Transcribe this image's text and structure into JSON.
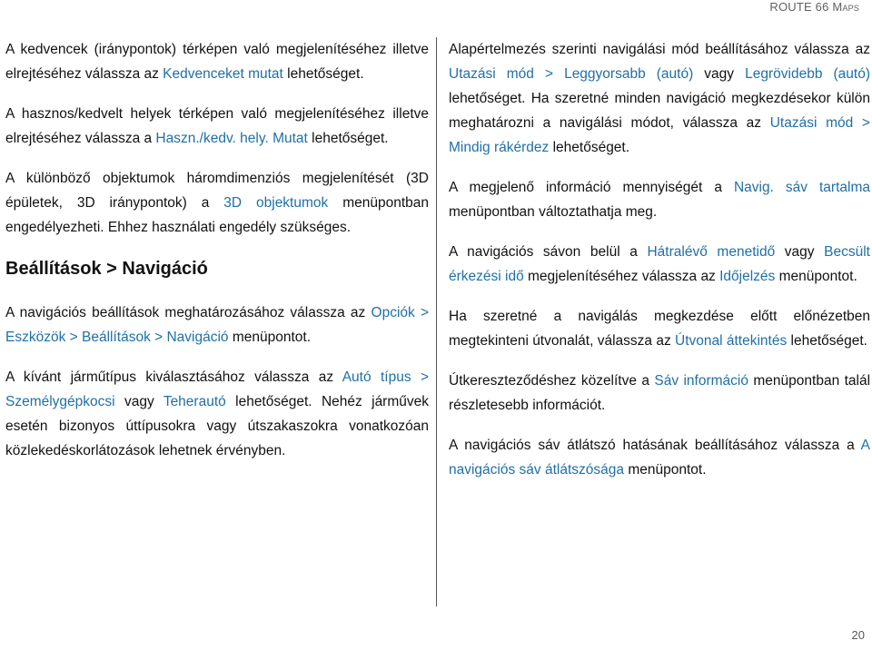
{
  "header": {
    "title_main": "ROUTE 66 ",
    "title_sc": "Maps"
  },
  "left": {
    "p1": {
      "t1": "A kedvencek (iránypontok) térképen való megjelenítéséhez illetve elrejtéséhez válassza az ",
      "l1": "Kedvenceket mutat",
      "t2": " lehetőséget."
    },
    "p2": {
      "t1": "A hasznos/kedvelt helyek térképen való megjelenítéséhez illetve elrejtéséhez válassza a ",
      "l1": "Haszn./kedv. hely. Mutat",
      "t2": " lehetőséget."
    },
    "p3": {
      "t1": "A különböző objektumok háromdimenziós megjelenítését (3D épületek, 3D iránypontok) a ",
      "l1": "3D objektumok",
      "t2": " menüpontban engedélyezheti. Ehhez használati engedély szükséges."
    },
    "heading": "Beállítások > Navigáció",
    "p4": {
      "t1": "A navigációs beállítások meghatározásához válassza az ",
      "l1": "Opciók > Eszközök > Beállítások > Navigáció",
      "t2": " menüpontot."
    },
    "p5": {
      "t1": "A kívánt járműtípus kiválasztásához válassza az ",
      "l1": "Autó típus > Személygépkocsi",
      "t2": " vagy ",
      "l2": "Teherautó",
      "t3": " lehetőséget. Nehéz járművek esetén bizonyos úttípusokra vagy útszakaszokra vonatkozóan közlekedéskorlátozások lehetnek érvényben."
    }
  },
  "right": {
    "p1": {
      "t1": "Alapértelmezés szerinti navigálási mód beállításához válassza az ",
      "l1": "Utazási mód > Leggyorsabb (autó)",
      "t2": " vagy ",
      "l2": "Legrövidebb (autó)",
      "t3": " lehetőséget. Ha szeretné minden navigáció megkezdésekor külön meghatározni a navigálási módot, válassza az ",
      "l3": "Utazási mód > Mindig rákérdez",
      "t4": " lehetőséget."
    },
    "p2": {
      "t1": "A megjelenő információ mennyiségét a ",
      "l1": "Navig. sáv tartalma",
      "t2": " menüpontban változtathatja meg."
    },
    "p3": {
      "t1": "A navigációs sávon belül a ",
      "l1": "Hátralévő menetidő",
      "t2": " vagy ",
      "l2": "Becsült érkezési idő",
      "t3": " megjelenítéséhez válassza az ",
      "l3": "Időjelzés",
      "t4": " menüpontot."
    },
    "p4": {
      "t1": "Ha szeretné a navigálás megkezdése előtt előnézetben megtekinteni útvonalát, válassza az ",
      "l1": "Útvonal áttekintés",
      "t2": " lehetőséget."
    },
    "p5": {
      "t1": "Útkereszteződéshez közelítve a ",
      "l1": "Sáv információ",
      "t2": " menüpontban talál részletesebb információt."
    },
    "p6": {
      "t1": "A navigációs sáv átlátszó hatásának beállításához válassza a ",
      "l1": "A navigációs sáv átlátszósága",
      "t2": " menüpontot."
    }
  },
  "page_number": "20",
  "colors": {
    "link": "#1f6fa8",
    "text": "#111111",
    "header": "#606060"
  }
}
